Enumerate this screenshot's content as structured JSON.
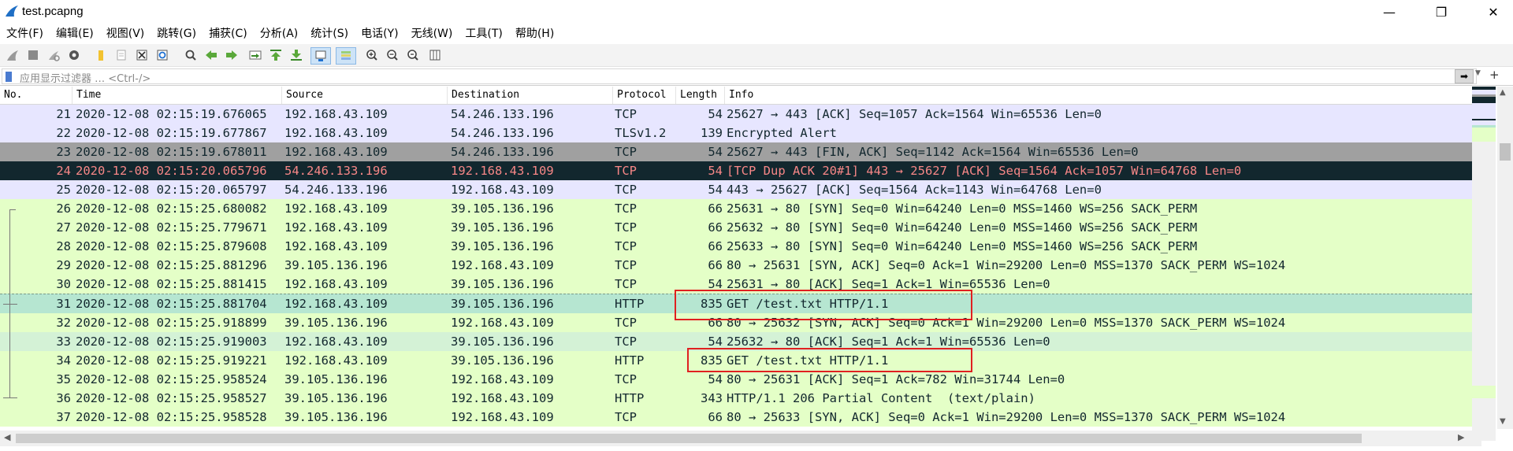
{
  "window": {
    "title": "test.pcapng",
    "minimize": "—",
    "maximize": "❐",
    "close": "✕"
  },
  "menu": [
    "文件(F)",
    "编辑(E)",
    "视图(V)",
    "跳转(G)",
    "捕获(C)",
    "分析(A)",
    "统计(S)",
    "电话(Y)",
    "无线(W)",
    "工具(T)",
    "帮助(H)"
  ],
  "toolbar_icons": [
    "shark-fin-start-icon",
    "stop-icon",
    "restart-icon",
    "options-gear-icon",
    "open-folder-icon",
    "file-icon",
    "close-file-icon",
    "reload-icon",
    "find-icon",
    "go-back-icon",
    "go-forward-icon",
    "go-to-packet-icon",
    "first-packet-icon",
    "last-packet-icon",
    "autoscroll-icon",
    "colorize-icon",
    "zoom-in-icon",
    "zoom-out-icon",
    "normal-size-icon",
    "resize-columns-icon"
  ],
  "filter": {
    "placeholder": "应用显示过滤器 … <Ctrl-/>",
    "apply_icon": "arrow-right-icon",
    "add_label": "+"
  },
  "columns": [
    "No.",
    "Time",
    "Source",
    "Destination",
    "Protocol",
    "Length",
    "Info"
  ],
  "rows": [
    {
      "no": "21",
      "time": "2020-12-08 02:15:19.676065",
      "src": "192.168.43.109",
      "dst": "54.246.133.196",
      "proto": "TCP",
      "len": "54",
      "info": "25627 → 443 [ACK] Seq=1057 Ack=1564 Win=65536 Len=0",
      "bg": "#e7e6ff",
      "fg": "#12272e"
    },
    {
      "no": "22",
      "time": "2020-12-08 02:15:19.677867",
      "src": "192.168.43.109",
      "dst": "54.246.133.196",
      "proto": "TLSv1.2",
      "len": "139",
      "info": "Encrypted Alert",
      "bg": "#e7e6ff",
      "fg": "#12272e"
    },
    {
      "no": "23",
      "time": "2020-12-08 02:15:19.678011",
      "src": "192.168.43.109",
      "dst": "54.246.133.196",
      "proto": "TCP",
      "len": "54",
      "info": "25627 → 443 [FIN, ACK] Seq=1142 Ack=1564 Win=65536 Len=0",
      "bg": "#a0a0a0",
      "fg": "#12272e"
    },
    {
      "no": "24",
      "time": "2020-12-08 02:15:20.065796",
      "src": "54.246.133.196",
      "dst": "192.168.43.109",
      "proto": "TCP",
      "len": "54",
      "info": "[TCP Dup ACK 20#1] 443 → 25627 [ACK] Seq=1564 Ack=1057 Win=64768 Len=0",
      "bg": "#12272e",
      "fg": "#f78787"
    },
    {
      "no": "25",
      "time": "2020-12-08 02:15:20.065797",
      "src": "54.246.133.196",
      "dst": "192.168.43.109",
      "proto": "TCP",
      "len": "54",
      "info": "443 → 25627 [ACK] Seq=1564 Ack=1143 Win=64768 Len=0",
      "bg": "#e7e6ff",
      "fg": "#12272e"
    },
    {
      "no": "26",
      "time": "2020-12-08 02:15:25.680082",
      "src": "192.168.43.109",
      "dst": "39.105.136.196",
      "proto": "TCP",
      "len": "66",
      "info": "25631 → 80 [SYN] Seq=0 Win=64240 Len=0 MSS=1460 WS=256 SACK_PERM",
      "bg": "#e4ffc7",
      "fg": "#12272e"
    },
    {
      "no": "27",
      "time": "2020-12-08 02:15:25.779671",
      "src": "192.168.43.109",
      "dst": "39.105.136.196",
      "proto": "TCP",
      "len": "66",
      "info": "25632 → 80 [SYN] Seq=0 Win=64240 Len=0 MSS=1460 WS=256 SACK_PERM",
      "bg": "#e4ffc7",
      "fg": "#12272e"
    },
    {
      "no": "28",
      "time": "2020-12-08 02:15:25.879608",
      "src": "192.168.43.109",
      "dst": "39.105.136.196",
      "proto": "TCP",
      "len": "66",
      "info": "25633 → 80 [SYN] Seq=0 Win=64240 Len=0 MSS=1460 WS=256 SACK_PERM",
      "bg": "#e4ffc7",
      "fg": "#12272e"
    },
    {
      "no": "29",
      "time": "2020-12-08 02:15:25.881296",
      "src": "39.105.136.196",
      "dst": "192.168.43.109",
      "proto": "TCP",
      "len": "66",
      "info": "80 → 25631 [SYN, ACK] Seq=0 Ack=1 Win=29200 Len=0 MSS=1370 SACK_PERM WS=1024",
      "bg": "#e4ffc7",
      "fg": "#12272e"
    },
    {
      "no": "30",
      "time": "2020-12-08 02:15:25.881415",
      "src": "192.168.43.109",
      "dst": "39.105.136.196",
      "proto": "TCP",
      "len": "54",
      "info": "25631 → 80 [ACK] Seq=1 Ack=1 Win=65536 Len=0",
      "bg": "#e4ffc7",
      "fg": "#12272e"
    },
    {
      "no": "31",
      "time": "2020-12-08 02:15:25.881704",
      "src": "192.168.43.109",
      "dst": "39.105.136.196",
      "proto": "HTTP",
      "len": "835",
      "info": "GET /test.txt HTTP/1.1",
      "bg": "#b6e6d1",
      "fg": "#12272e",
      "selected": true
    },
    {
      "no": "32",
      "time": "2020-12-08 02:15:25.918899",
      "src": "39.105.136.196",
      "dst": "192.168.43.109",
      "proto": "TCP",
      "len": "66",
      "info": "80 → 25632 [SYN, ACK] Seq=0 Ack=1 Win=29200 Len=0 MSS=1370 SACK_PERM WS=1024",
      "bg": "#e4ffc7",
      "fg": "#12272e"
    },
    {
      "no": "33",
      "time": "2020-12-08 02:15:25.919003",
      "src": "192.168.43.109",
      "dst": "39.105.136.196",
      "proto": "TCP",
      "len": "54",
      "info": "25632 → 80 [ACK] Seq=1 Ack=1 Win=65536 Len=0",
      "bg": "#d4f2d6",
      "fg": "#12272e"
    },
    {
      "no": "34",
      "time": "2020-12-08 02:15:25.919221",
      "src": "192.168.43.109",
      "dst": "39.105.136.196",
      "proto": "HTTP",
      "len": "835",
      "info": "GET /test.txt HTTP/1.1",
      "bg": "#e4ffc7",
      "fg": "#12272e"
    },
    {
      "no": "35",
      "time": "2020-12-08 02:15:25.958524",
      "src": "39.105.136.196",
      "dst": "192.168.43.109",
      "proto": "TCP",
      "len": "54",
      "info": "80 → 25631 [ACK] Seq=1 Ack=782 Win=31744 Len=0",
      "bg": "#e4ffc7",
      "fg": "#12272e"
    },
    {
      "no": "36",
      "time": "2020-12-08 02:15:25.958527",
      "src": "39.105.136.196",
      "dst": "192.168.43.109",
      "proto": "HTTP",
      "len": "343",
      "info": "HTTP/1.1 206 Partial Content  (text/plain)",
      "bg": "#e4ffc7",
      "fg": "#12272e"
    },
    {
      "no": "37",
      "time": "2020-12-08 02:15:25.958528",
      "src": "39.105.136.196",
      "dst": "192.168.43.109",
      "proto": "TCP",
      "len": "66",
      "info": "80 → 25633 [SYN, ACK] Seq=0 Ack=1 Win=29200 Len=0 MSS=1370 SACK_PERM WS=1024",
      "bg": "#e4ffc7",
      "fg": "#12272e"
    }
  ],
  "colors": {
    "annotation_box": "#e02020",
    "selected_row": "#b6e6d1",
    "http_tcp_row": "#e4ffc7",
    "tls_row": "#e7e6ff",
    "bad_tcp_row": "#12272e",
    "bad_tcp_text": "#f78787",
    "fin_row": "#a0a0a0"
  }
}
